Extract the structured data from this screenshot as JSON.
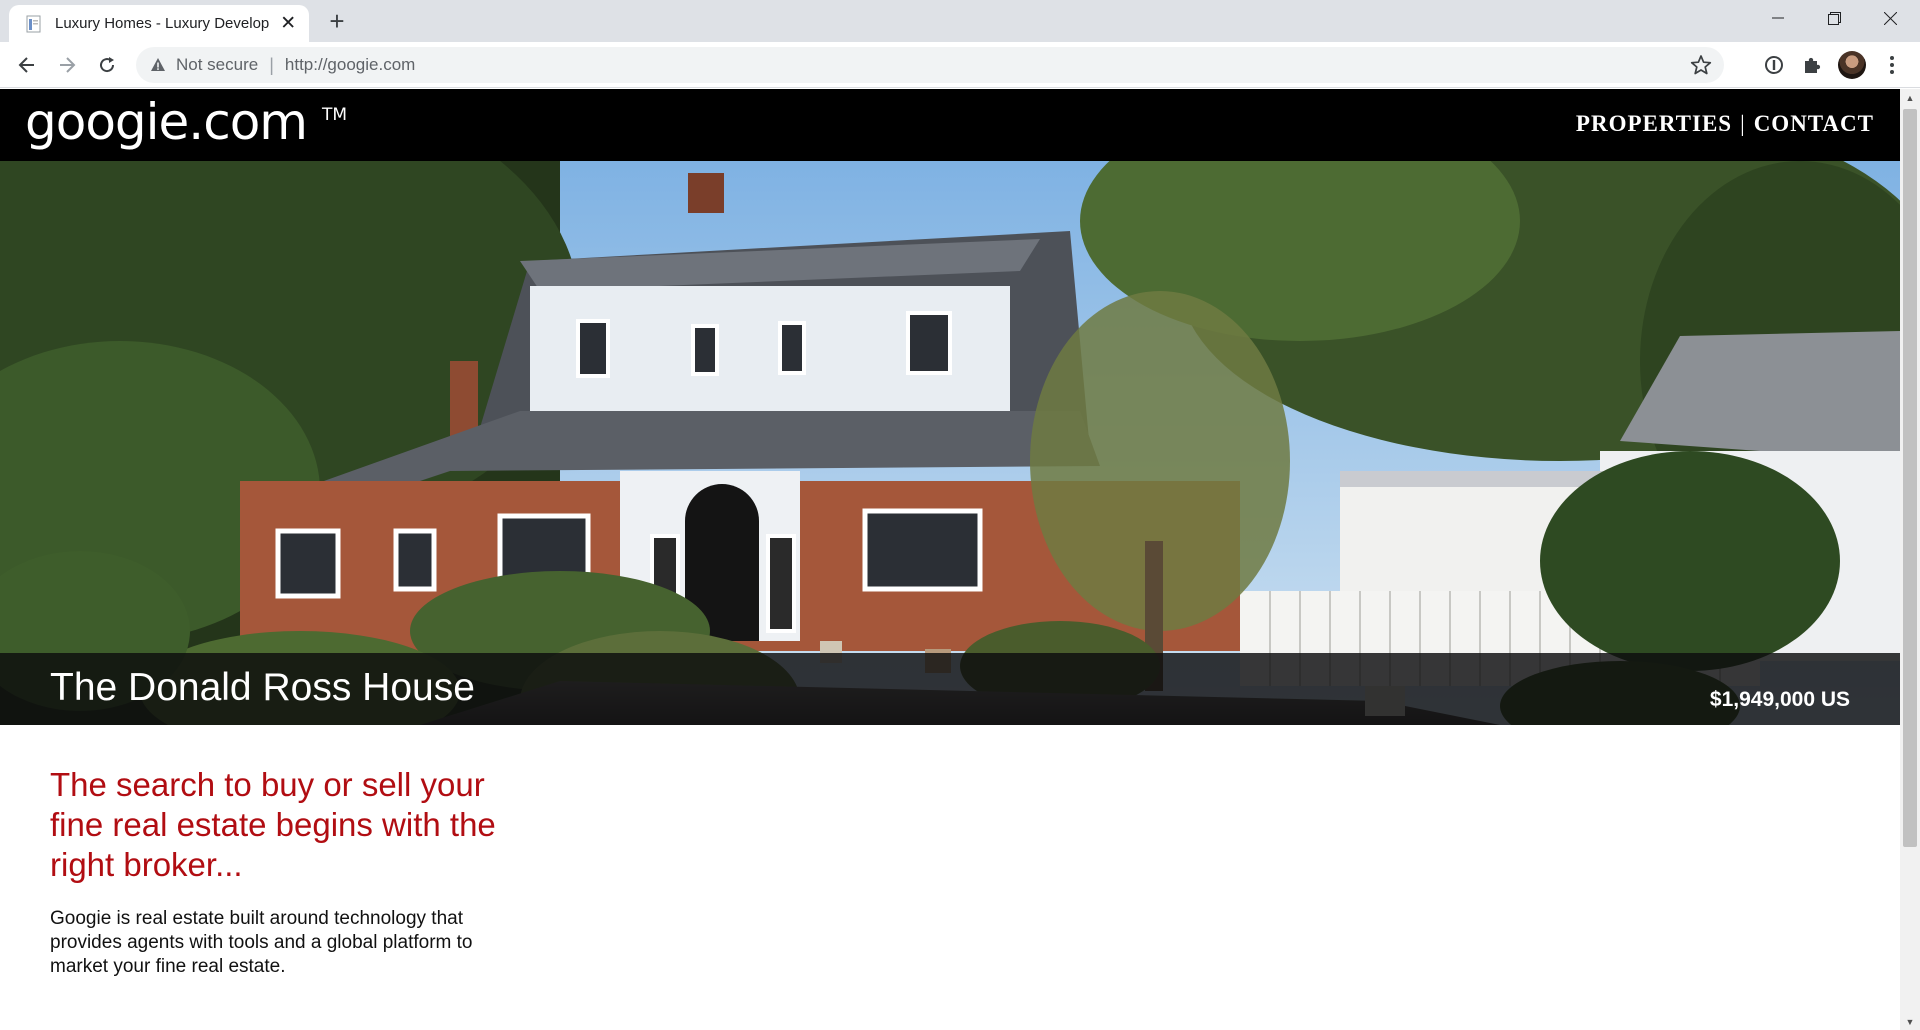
{
  "browser": {
    "tab_title": "Luxury Homes - Luxury Developm",
    "security_label": "Not secure",
    "url": "http://googie.com"
  },
  "site": {
    "logo_text": "googie.com",
    "logo_tm": "TM",
    "nav": {
      "properties": "PROPERTIES",
      "separator": "|",
      "contact": "CONTACT"
    }
  },
  "hero": {
    "title": "The Donald Ross House",
    "price": "$1,949,000 US"
  },
  "content": {
    "tagline": "The search to buy or sell your fine real estate begins with the right broker...",
    "intro": "Googie is real estate built around technology that provides agents with tools and a global platform to market your fine real estate."
  },
  "colors": {
    "header_bg": "#000000",
    "tagline_red": "#b10d12",
    "caption_bar": "#0c0c0e"
  }
}
